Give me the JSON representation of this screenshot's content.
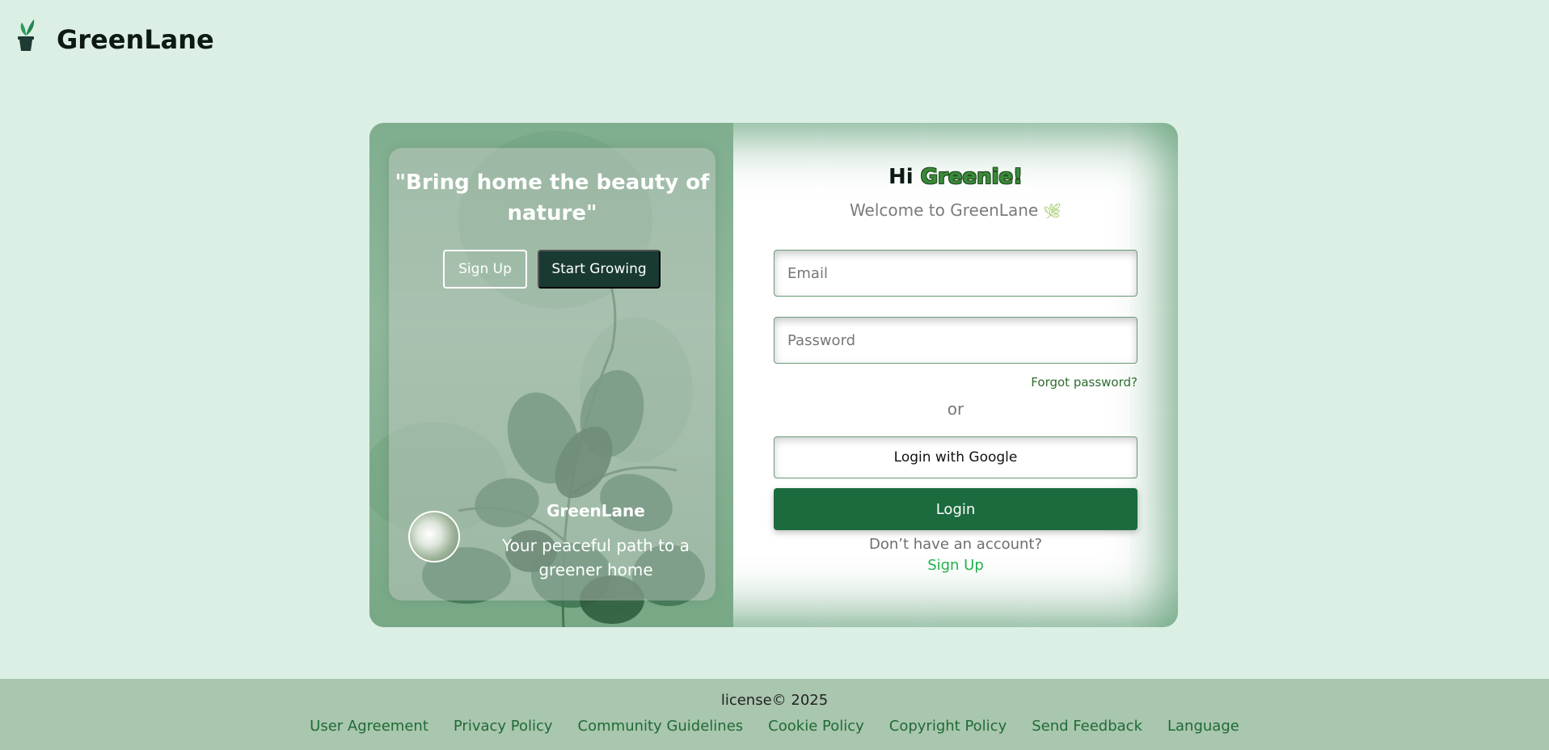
{
  "header": {
    "brand": "GreenLane",
    "logo_icon": "potted-plant-icon"
  },
  "left_panel": {
    "quote": "\"Bring home the beauty of nature\"",
    "signup_label": "Sign Up",
    "start_label": "Start Growing",
    "brand": "GreenLane",
    "tagline": "Your peaceful path to a greener home"
  },
  "login": {
    "greeting_prefix": "Hi ",
    "greeting_accent": "Greenie!",
    "welcome": "Welcome to GreenLane",
    "welcome_icon": "leaf-sprig-icon",
    "email_placeholder": "Email",
    "password_placeholder": "Password",
    "forgot": "Forgot password?",
    "or": "or",
    "google_label": "Login with Google",
    "login_label": "Login",
    "no_account": "Don’t have an account?",
    "signup_link": "Sign Up"
  },
  "footer": {
    "license": "license© 2025",
    "links": [
      "User Agreement",
      "Privacy Policy",
      "Community Guidelines",
      "Cookie Policy",
      "Copyright Policy",
      "Send Feedback",
      "Language"
    ]
  },
  "colors": {
    "page_bg": "#dcefe4",
    "accent_green": "#1b6b3e",
    "dark_button": "#183a33",
    "footer_bg": "#a9c6ae",
    "link_green": "#23b04f"
  }
}
